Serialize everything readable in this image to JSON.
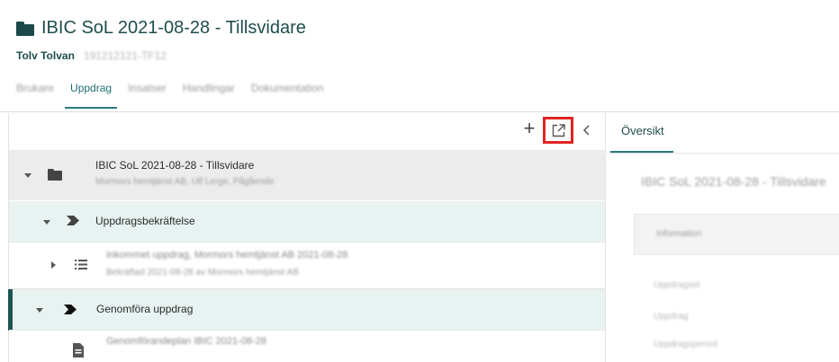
{
  "header": {
    "title": "IBIC SoL 2021-08-28 - Tillsvidare",
    "person_name": "Tolv Tolvan",
    "person_id": "191212121-TF12"
  },
  "tabs": [
    {
      "label": "Brukare"
    },
    {
      "label": "Uppdrag"
    },
    {
      "label": "Insatser"
    },
    {
      "label": "Handlingar"
    },
    {
      "label": "Dokumentation"
    }
  ],
  "toolbar": {
    "add_symbol": "+"
  },
  "tree": {
    "row1_title": "IBIC SoL 2021-08-28 - Tillsvidare",
    "row1_sub": "Mormors hemtjänst AB, Ulf Lerge, Pågående",
    "row2_title": "Uppdragsbekräftelse",
    "row3_title": "Inkommet uppdrag, Mormors hemtjänst AB 2021-08-28",
    "row3_sub": "Bekräftad 2021-08-28 av Mormors hemtjänst AB",
    "row4_title": "Genomföra uppdrag",
    "row5_title": "Genomförandeplan IBIC 2021-08-28"
  },
  "right_panel": {
    "tab_label": "Översikt",
    "heading": "IBIC SoL 2021-08-28 - Tillsvidare",
    "box_label": "Information",
    "fields": [
      "Uppdragsid",
      "Uppdrag",
      "Uppdragsperiod"
    ]
  },
  "colors": {
    "accent": "#2a7a7c",
    "title": "#1f4d4d",
    "highlight_box": "#e02424",
    "row_selected": "#e8f2f1"
  }
}
